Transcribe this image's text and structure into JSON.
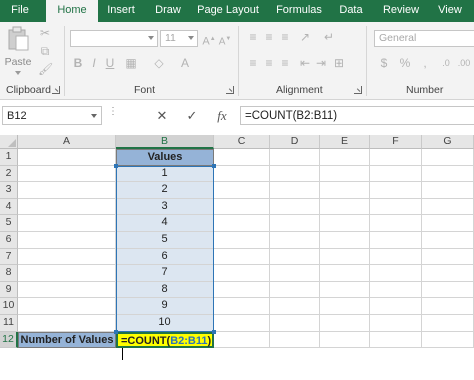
{
  "ribbon_tabs": [
    "File",
    "Home",
    "Insert",
    "Draw",
    "Page Layout",
    "Formulas",
    "Data",
    "Review",
    "View"
  ],
  "active_tab": "Home",
  "ribbon": {
    "paste_label": "Paste",
    "font_size": "11",
    "number_format": "General",
    "groups": {
      "clipboard": "Clipboard",
      "font": "Font",
      "alignment": "Alignment",
      "number": "Number"
    }
  },
  "formula_bar": {
    "name_box": "B12",
    "formula": "=COUNT(B2:B11)",
    "fx_label": "fx"
  },
  "columns": [
    "A",
    "B",
    "C",
    "D",
    "E",
    "F",
    "G"
  ],
  "rows": [
    "1",
    "2",
    "3",
    "4",
    "5",
    "6",
    "7",
    "8",
    "9",
    "10",
    "11",
    "12"
  ],
  "cells": {
    "B1": "Values",
    "values": [
      "1",
      "2",
      "3",
      "4",
      "5",
      "6",
      "7",
      "8",
      "9",
      "10"
    ],
    "A12": "Number of Values",
    "B12_prefix": "=COUNT(",
    "B12_ref": "B2:B11",
    "B12_suffix": ")"
  },
  "colors": {
    "accent": "#217346",
    "header_fill": "#95b3d7",
    "value_fill": "#dce6f1",
    "active_fill": "#ffff00",
    "range_border": "#2e75b6"
  }
}
